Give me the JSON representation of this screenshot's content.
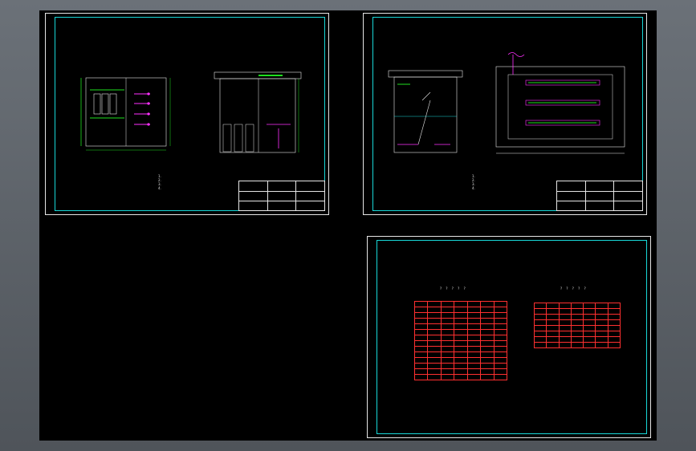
{
  "window": {
    "viewer": "CAD drawing viewer"
  },
  "sheets": [
    {
      "id": "sheet-1",
      "notes": "1.\n2.\n3.\n4."
    },
    {
      "id": "sheet-2",
      "notes": "1.\n2.\n3.\n4."
    },
    {
      "id": "sheet-3",
      "notes": ""
    }
  ],
  "tables": {
    "left_title": "? ? ? ? ?",
    "right_title": "? ? ? ? ?",
    "left_rows": 14,
    "right_rows": 8
  },
  "colors": {
    "background": "#000000",
    "frame": "#e6e6e6",
    "inner_frame": "#18d8d8",
    "table_lines": "#ff3030",
    "accent_green": "#20e020",
    "accent_magenta": "#ff30ff",
    "accent_yellow": "#e0e020"
  }
}
